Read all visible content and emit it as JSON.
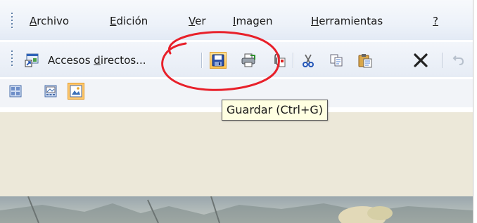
{
  "menu": {
    "items": [
      {
        "accel": "A",
        "rest": "rchivo"
      },
      {
        "accel": "E",
        "rest": "dición"
      },
      {
        "accel": "V",
        "rest": "er"
      },
      {
        "accel": "I",
        "rest": "magen"
      },
      {
        "accel": "H",
        "rest": "erramientas"
      },
      {
        "accel": "?",
        "rest": ""
      }
    ]
  },
  "toolbar": {
    "shortcuts_pre": "Accesos ",
    "shortcuts_accel": "d",
    "shortcuts_post": "irectos..."
  },
  "tooltip": {
    "text": "Guardar (Ctrl+G)"
  },
  "colors": {
    "annotation": "#e8202a",
    "tooltip_bg": "#ffffe1",
    "active_button": "#ffc14a"
  }
}
